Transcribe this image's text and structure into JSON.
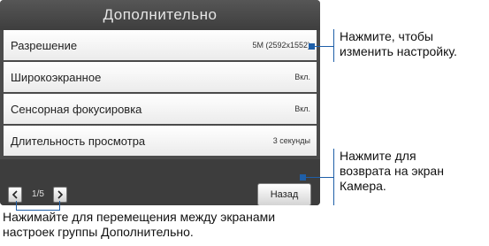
{
  "panel": {
    "title": "Дополнительно",
    "settings": [
      {
        "label": "Разрешение",
        "value": "5M (2592x1552)"
      },
      {
        "label": "Широкоэкранное",
        "value": "Вкл."
      },
      {
        "label": "Сенсорная фокусировка",
        "value": "Вкл."
      },
      {
        "label": "Длительность просмотра",
        "value": "3 секунды"
      }
    ],
    "pager": {
      "text": "1/5"
    },
    "back_label": "Назад"
  },
  "callouts": {
    "setting_change": [
      "Нажмите, чтобы",
      "изменить настройку."
    ],
    "back_to_camera": [
      "Нажмите для",
      "возврата на экран",
      "Камера."
    ],
    "navigation": [
      "Нажимайте для перемещения между экранами",
      "настроек группы Дополнительно."
    ]
  },
  "colors": {
    "leader": "#1f5fa8",
    "panel": "#4b4b4b"
  },
  "icons": {
    "prev": "chevron-left-icon",
    "next": "chevron-right-icon"
  }
}
